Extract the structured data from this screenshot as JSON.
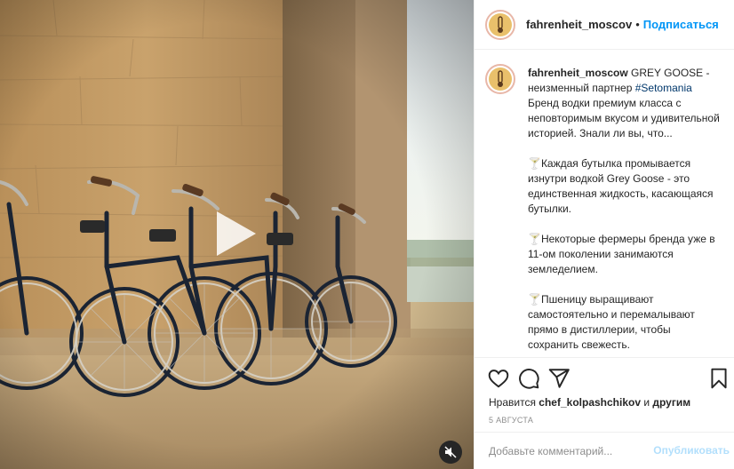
{
  "header": {
    "username": "fahrenheit_moscov",
    "separator": "•",
    "follow_label": "Подписаться"
  },
  "caption": {
    "username": "fahrenheit_moscow",
    "lead": " GREY GOOSE - неизменный партнер ",
    "hashtag": "#Setomania",
    "intro": " Бренд водки премиум класса с неповторимым вкусом и удивительной историей. Знали ли вы, что...",
    "para1": "🍸Каждая бутылка промывается изнутри водкой Grey Goose - это единственная жидкость, касающаяся бутылки.",
    "para2": "🍸Некоторые фермеры бренда уже в 11-ом поколении занимаются земледелием.",
    "para3": "🍸Пшеницу выращивают самостоятельно и перемалывают прямо в дистиллерии, чтобы сохранить свежесть."
  },
  "likes": {
    "prefix": "Нравится ",
    "user": "chef_kolpashchikov",
    "middle": " и ",
    "others": "другим"
  },
  "date": "5 АВГУСТА",
  "comment": {
    "placeholder": "Добавьте комментарий...",
    "publish_label": "Опубликовать"
  },
  "icons": {
    "like": "heart-icon",
    "comment": "comment-icon",
    "share": "share-icon",
    "save": "bookmark-icon",
    "play": "play-icon",
    "mute": "speaker-muted-icon"
  },
  "colors": {
    "link": "#0095f6",
    "hashtag": "#00376b",
    "publish_disabled": "#b2dffc",
    "muted_text": "#8e8e8e"
  }
}
